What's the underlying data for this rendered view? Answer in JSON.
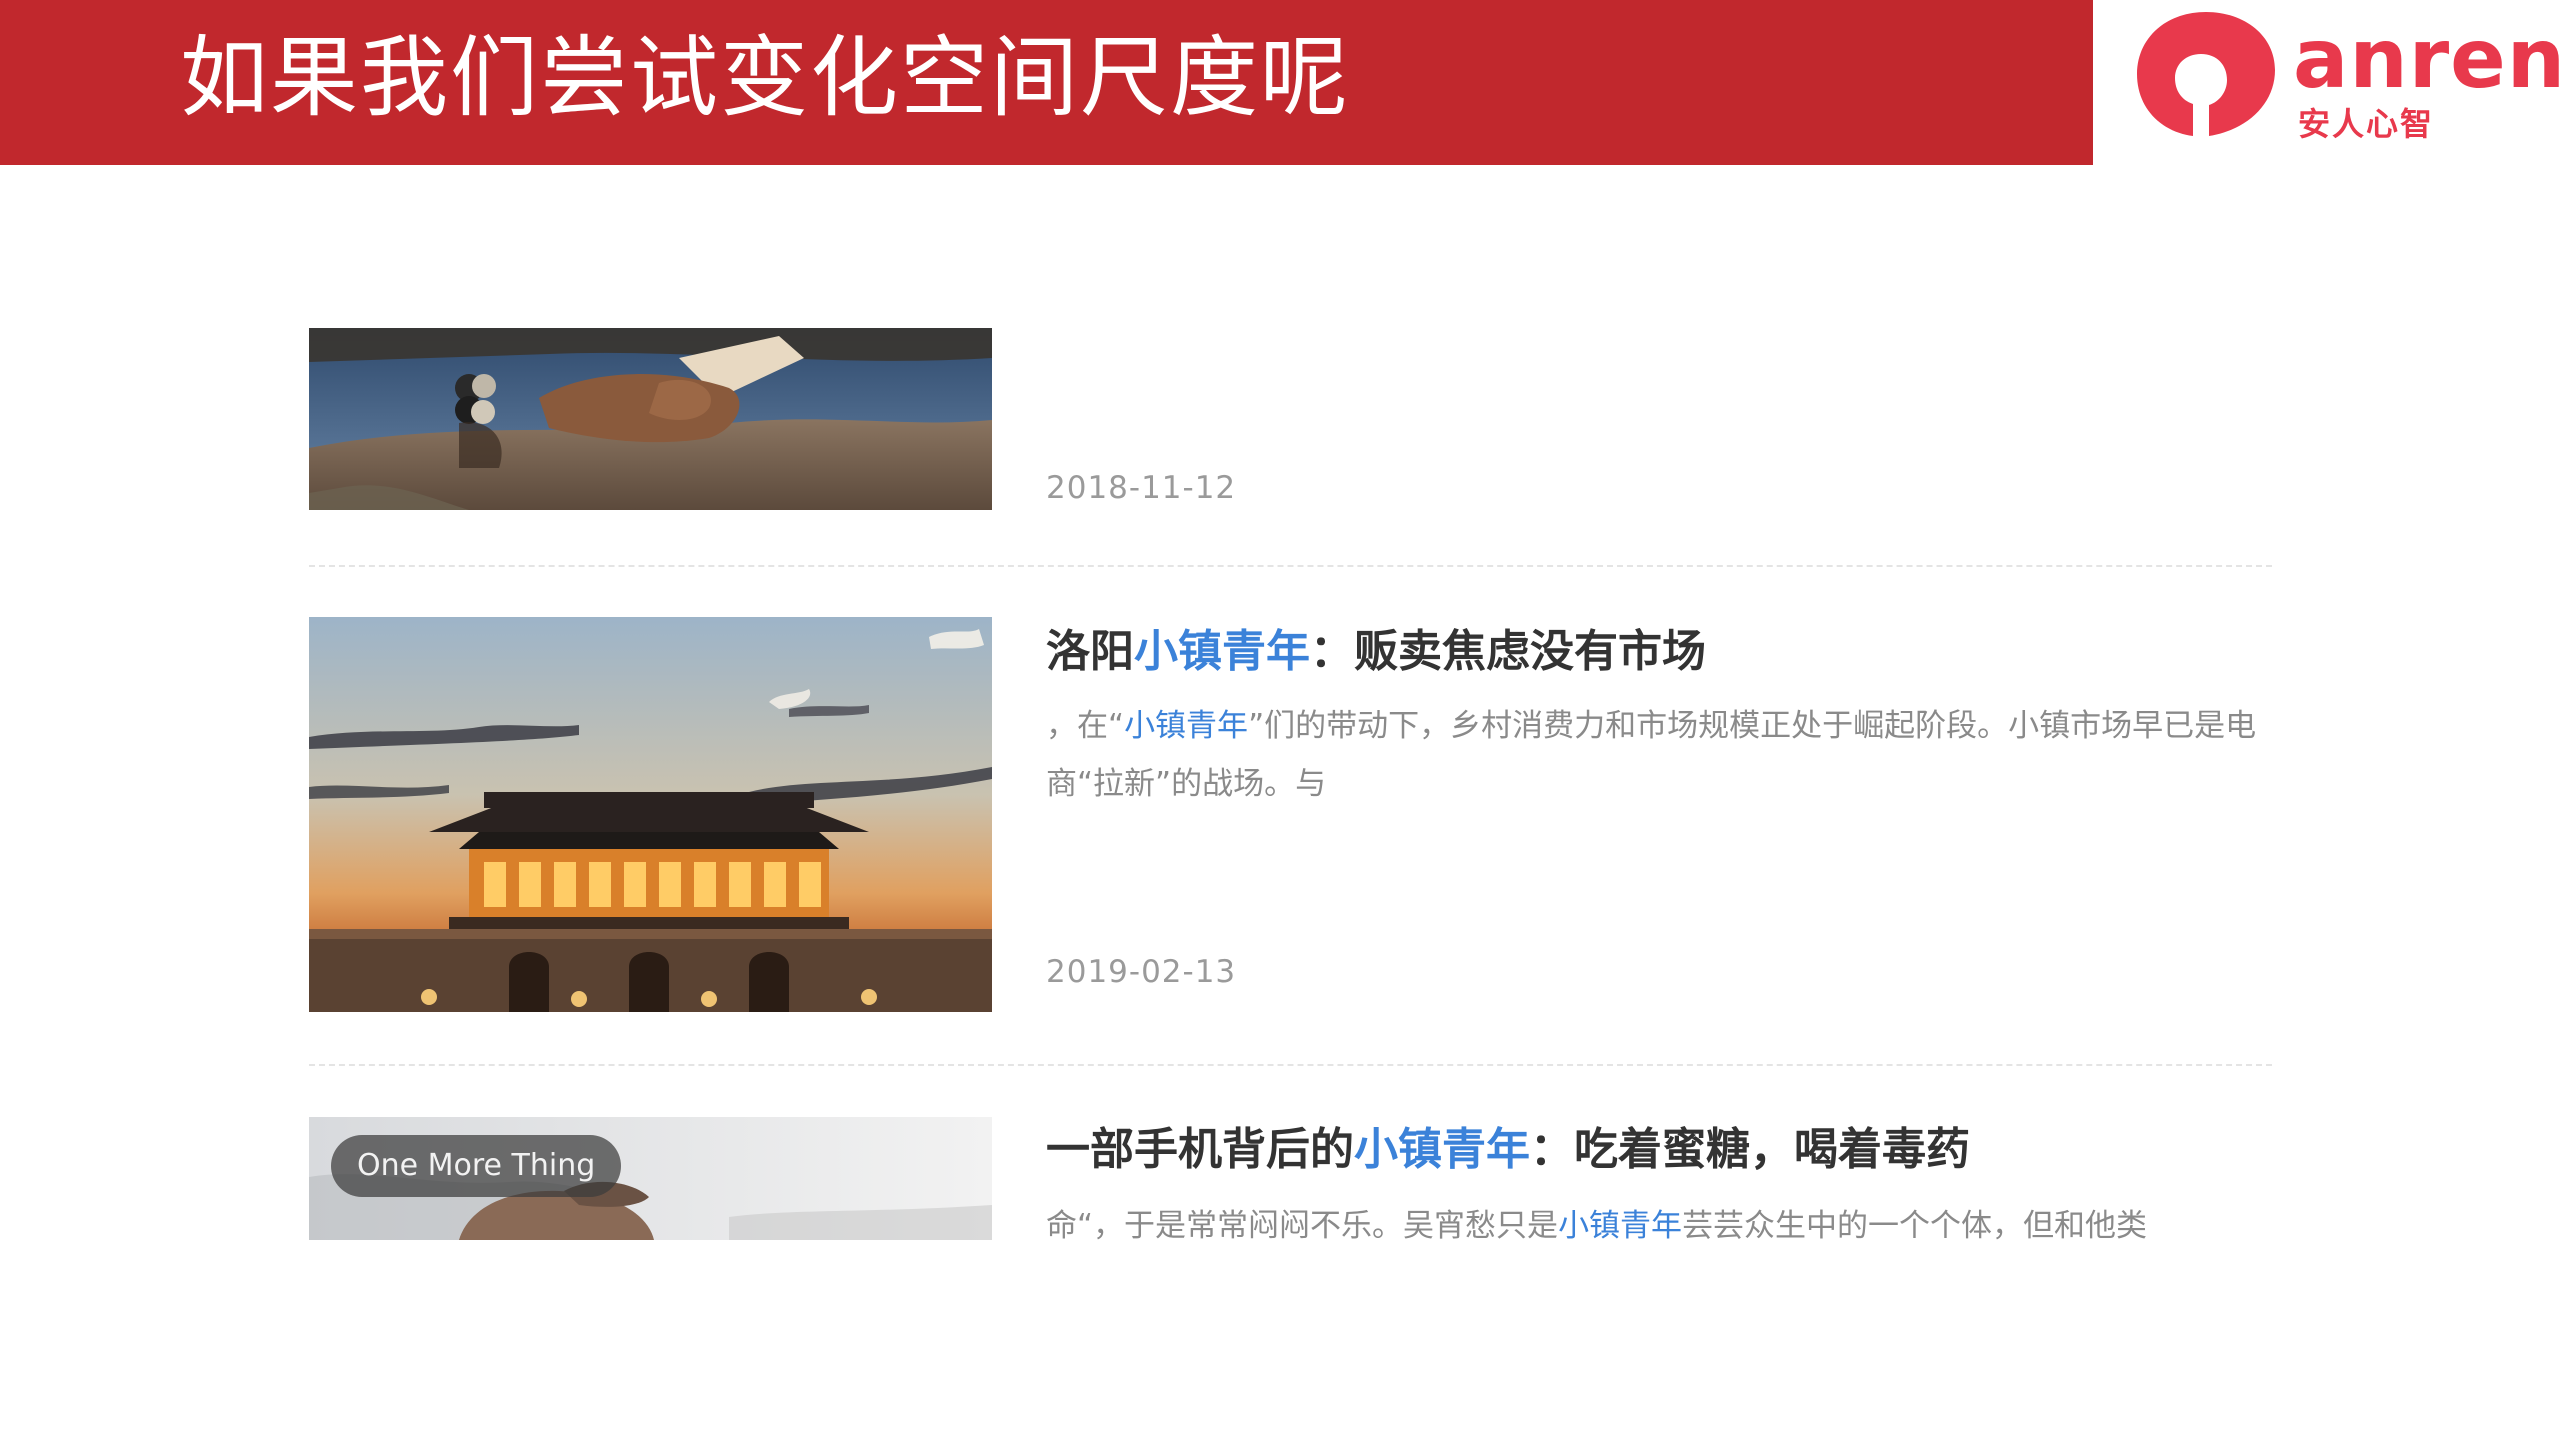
{
  "slide": {
    "title": "如果我们尝试变化空间尺度呢"
  },
  "logo": {
    "wordmark": "anren",
    "chinese": "安人心智",
    "color": "#e8394c"
  },
  "theme": {
    "header_color": "#c1282d",
    "highlight_color": "#3b82d9"
  },
  "articles": [
    {
      "date": "2018-11-12",
      "image": "hands-holding-book-photo"
    },
    {
      "title_before": "洛阳",
      "title_highlight": "小镇青年",
      "title_after": "：贩卖焦虑没有市场",
      "summary_1": "，在“",
      "summary_highlight": "小镇青年",
      "summary_2": "”们的带动下，乡村消费力和市场规模正处于崛起阶段。小镇市场早已是电商“拉新”的战场。与",
      "date": "2019-02-13",
      "image": "illuminated-palace-at-dusk-photo"
    },
    {
      "title_before": "一部手机背后的",
      "title_highlight": "小镇青年",
      "title_after": "：吃着蜜糖，喝着毒药",
      "summary_1": "命“，于是常常闷闷不乐。吴宵愁只是",
      "summary_highlight": "小镇青年",
      "summary_2": "芸芸众生中的一个个体，但和他类",
      "badge": "One More Thing",
      "image": "person-photo-cropped"
    }
  ]
}
